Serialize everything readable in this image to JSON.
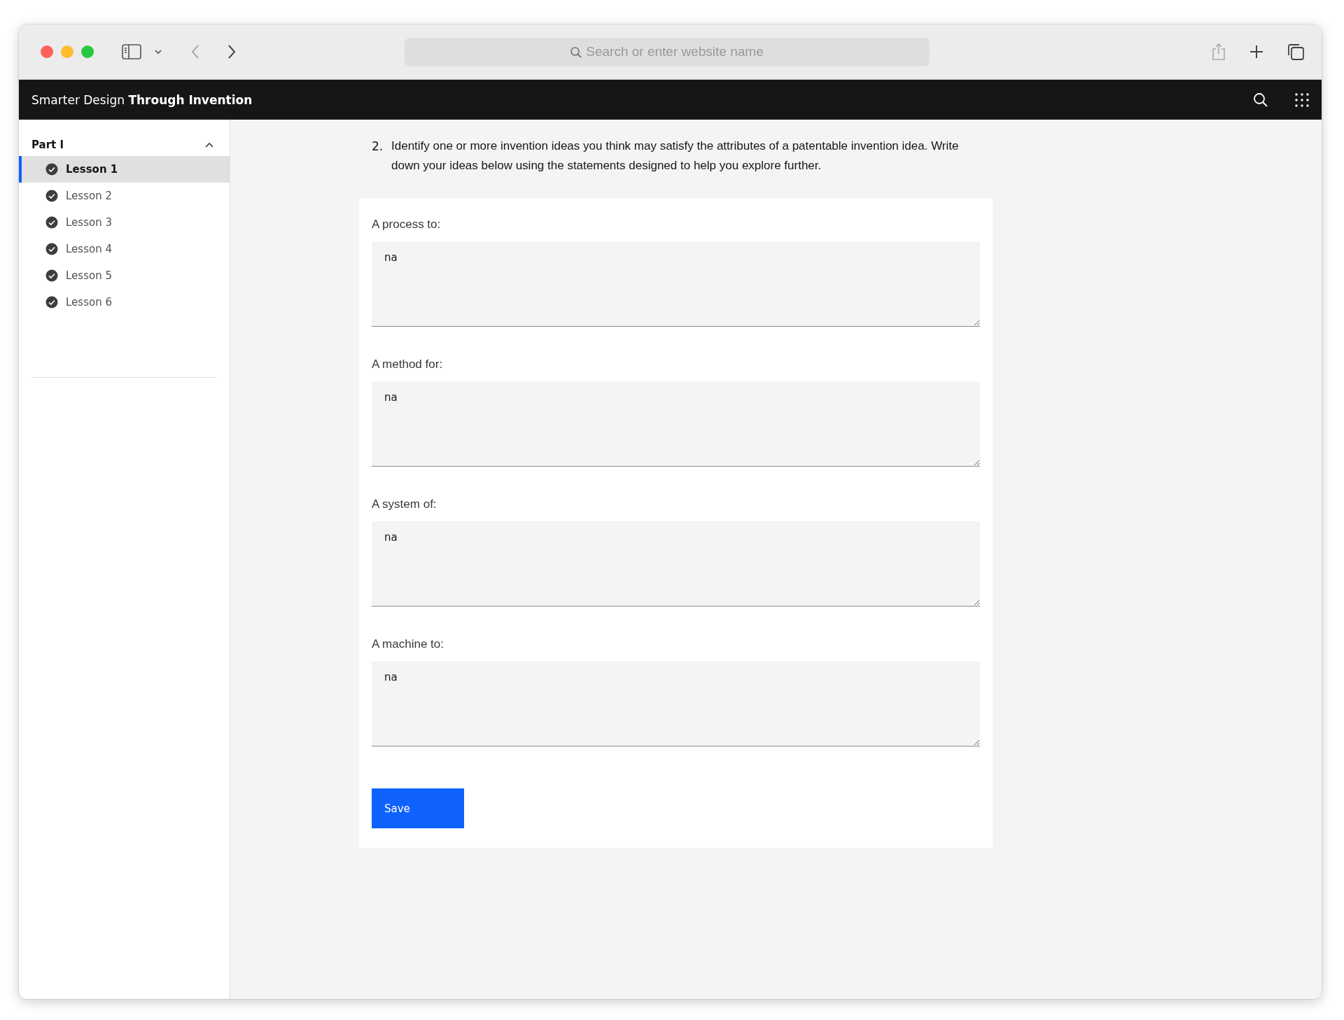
{
  "browser": {
    "address_placeholder": "Search or enter website name"
  },
  "header": {
    "title_regular": "Smarter Design",
    "title_bold": "Through Invention"
  },
  "sidebar": {
    "section": {
      "label": "Part I",
      "expanded": true
    },
    "items": [
      {
        "label": "Lesson 1",
        "completed": true,
        "selected": true
      },
      {
        "label": "Lesson 2",
        "completed": true,
        "selected": false
      },
      {
        "label": "Lesson 3",
        "completed": true,
        "selected": false
      },
      {
        "label": "Lesson 4",
        "completed": true,
        "selected": false
      },
      {
        "label": "Lesson 5",
        "completed": true,
        "selected": false
      },
      {
        "label": "Lesson 6",
        "completed": true,
        "selected": false
      }
    ]
  },
  "question": {
    "number": "2.",
    "text": "Identify one or more invention ideas you think may satisfy the attributes of a patentable invention idea. Write down your ideas below using the statements designed to help you explore further."
  },
  "fields": [
    {
      "label": "A process to:",
      "value": "na"
    },
    {
      "label": "A method for:",
      "value": "na"
    },
    {
      "label": "A system of:",
      "value": "na"
    },
    {
      "label": "A machine to:",
      "value": "na"
    }
  ],
  "save_button": "Save"
}
